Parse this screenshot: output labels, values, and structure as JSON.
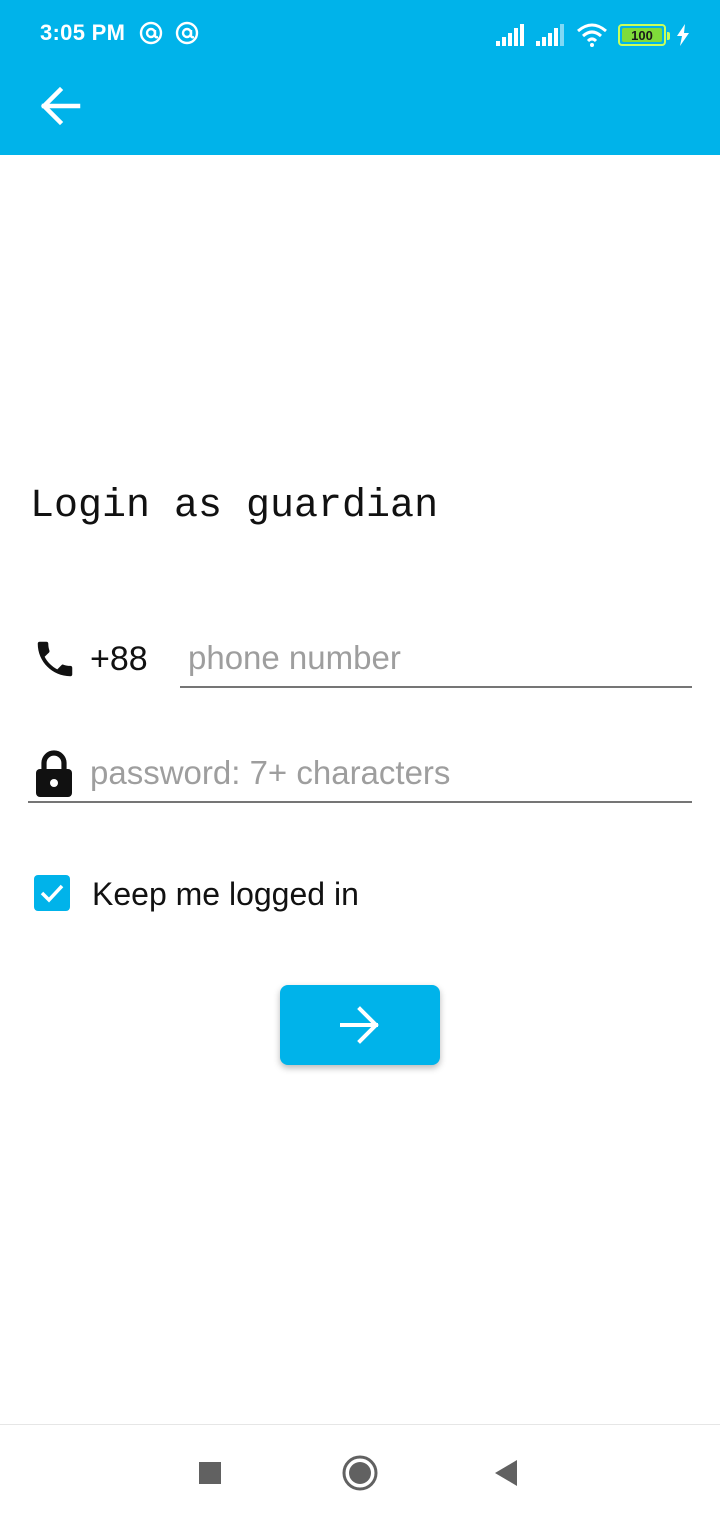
{
  "status_bar": {
    "time": "3:05 PM",
    "app_icons": [
      "at-sign-icon",
      "at-sign-icon"
    ],
    "signal_icons": [
      "signal-sim1-icon",
      "signal-sim2-icon"
    ],
    "wifi_icon": "wifi-icon",
    "battery_level": "100",
    "charging_icon": "bolt-icon"
  },
  "colors": {
    "primary": "#00b3ea",
    "text": "#111111",
    "placeholder": "#9e9e9e",
    "underline": "#757575"
  },
  "app_bar": {
    "back_icon": "arrow-left-icon"
  },
  "form": {
    "title": "Login as guardian",
    "phone_icon": "phone-icon",
    "country_code": "+88",
    "phone": {
      "value": "",
      "placeholder": "phone number"
    },
    "lock_icon": "lock-icon",
    "password": {
      "value": "",
      "placeholder": "password: 7+ characters"
    },
    "keep_logged_in": {
      "checked": true,
      "label": "Keep me logged in"
    },
    "submit_icon": "arrow-right-icon"
  },
  "nav_bar": {
    "items": [
      "recents-square-icon",
      "home-circle-icon",
      "back-triangle-icon"
    ]
  }
}
